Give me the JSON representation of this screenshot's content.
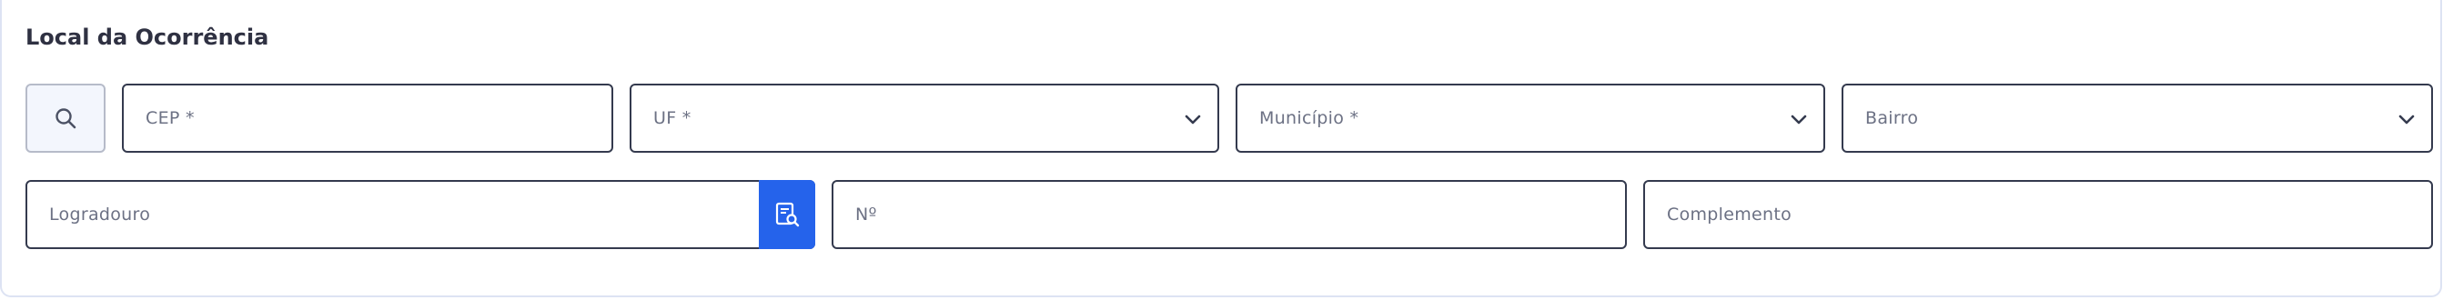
{
  "section": {
    "title": "Local da Ocorrência"
  },
  "row1": {
    "search_icon": "search-icon",
    "cep": {
      "placeholder": "CEP *",
      "value": ""
    },
    "uf": {
      "placeholder": "UF *",
      "selected": ""
    },
    "municipio": {
      "placeholder": "Município *",
      "selected": ""
    },
    "bairro": {
      "placeholder": "Bairro",
      "selected": ""
    }
  },
  "row2": {
    "logradouro": {
      "placeholder": "Logradouro",
      "value": "",
      "button_icon": "document-search-icon"
    },
    "numero": {
      "placeholder": "Nº",
      "value": ""
    },
    "complemento": {
      "placeholder": "Complemento",
      "value": ""
    }
  },
  "colors": {
    "accent": "#2563eb",
    "border": "#343a4e",
    "placeholder": "#6c7184",
    "title": "#2f3142",
    "panel_border": "#dde3f3"
  }
}
